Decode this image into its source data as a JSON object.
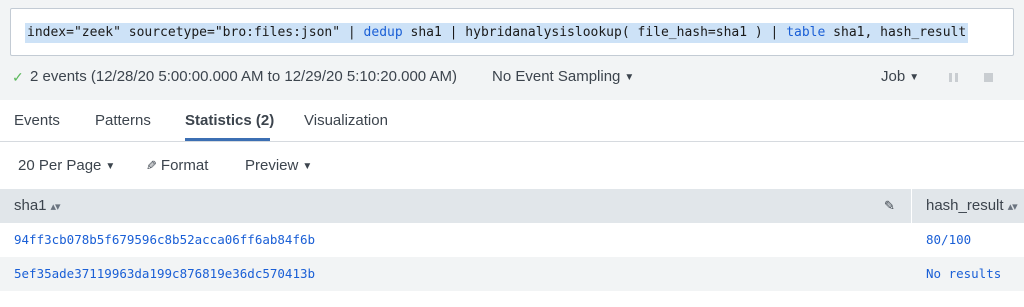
{
  "search": {
    "query_parts": [
      "index=\"zeek\" sourcetype=\"bro:files:json\" | ",
      "dedup",
      " sha1 | hybridanalysislookup( file_hash=sha1 ) | ",
      "table",
      " sha1, hash_result"
    ]
  },
  "status": {
    "events_summary": "2 events (12/28/20 5:00:00.000 AM to 12/29/20 5:10:20.000 AM)",
    "sampling_label": "No Event Sampling",
    "job_label": "Job"
  },
  "tabs": [
    {
      "label": "Events",
      "active": false
    },
    {
      "label": "Patterns",
      "active": false
    },
    {
      "label": "Statistics (2)",
      "active": true
    },
    {
      "label": "Visualization",
      "active": false
    }
  ],
  "controls": {
    "per_page": "20 Per Page",
    "format": "Format",
    "preview": "Preview"
  },
  "table": {
    "columns": [
      "sha1",
      "hash_result"
    ],
    "rows": [
      {
        "sha1": "94ff3cb078b5f679596c8b52acca06ff6ab84f6b",
        "hash_result": "80/100"
      },
      {
        "sha1": "5ef35ade37119963da199c876819e36dc570413b",
        "hash_result": "No results"
      }
    ]
  },
  "colors": {
    "query_highlight": "#cde2f7",
    "keyword": "#1a5fd6",
    "link": "#1a5fd6",
    "active_tab_underline": "#3c6fb3",
    "success_check": "#5cb85c"
  },
  "icons": [
    "check-icon",
    "caret-down-icon",
    "pause-icon",
    "stop-icon",
    "pencil-icon",
    "sort-icon"
  ]
}
